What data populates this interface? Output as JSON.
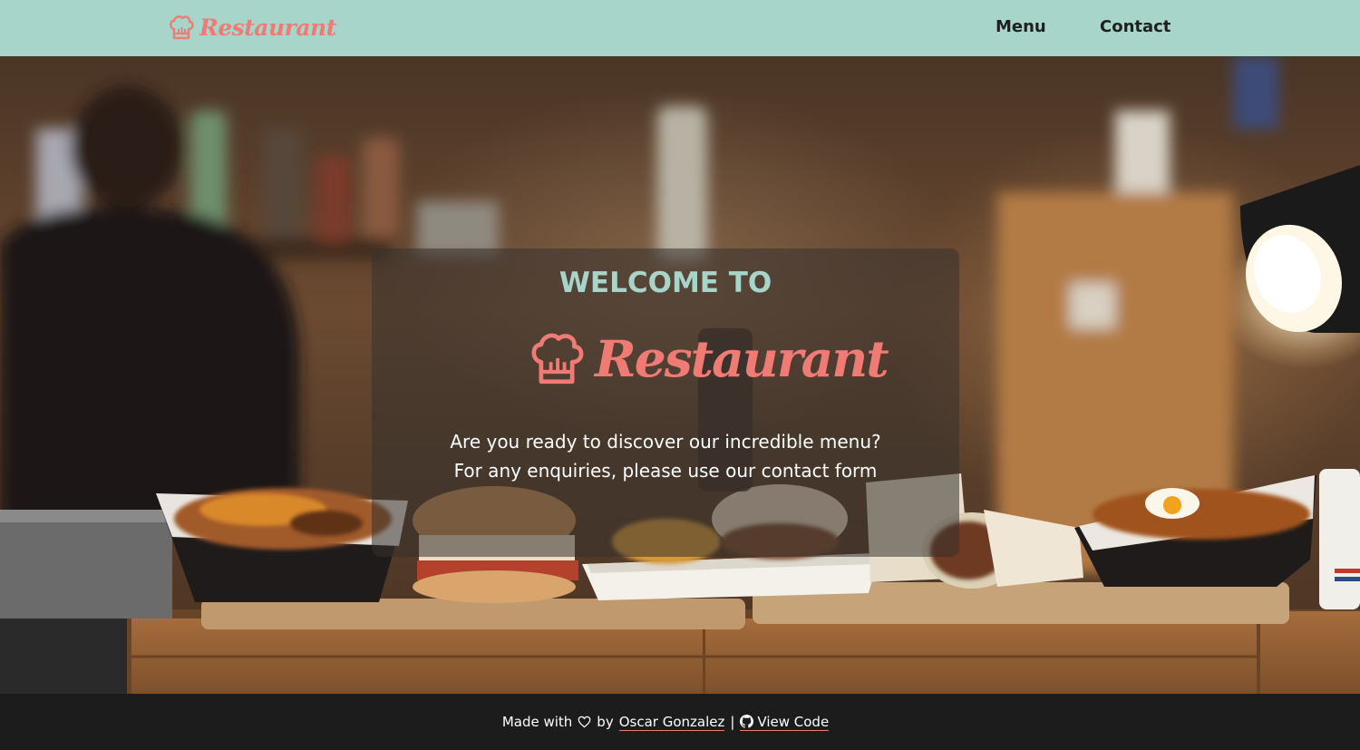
{
  "navbar": {
    "brand": "Restaurant",
    "links": [
      {
        "label": "Menu"
      },
      {
        "label": "Contact"
      }
    ]
  },
  "hero": {
    "title": "WELCOME TO",
    "logo_text": "Restaurant",
    "line1": "Are you ready to discover our incredible menu?",
    "line2": "For any enquiries, please use our contact form"
  },
  "footer": {
    "made_with": "Made with",
    "by": "by",
    "author": "Oscar Gonzalez",
    "separator": "|",
    "view_code": "View Code"
  },
  "icons": {
    "brand": "chef-hat-icon",
    "footer_heart": "heart-icon",
    "footer_code": "github-icon"
  },
  "colors": {
    "navbar_bg": "#a8d5c9",
    "accent": "#ef7b74",
    "title": "#a8d5c9",
    "footer_bg": "#1c1c1c"
  }
}
